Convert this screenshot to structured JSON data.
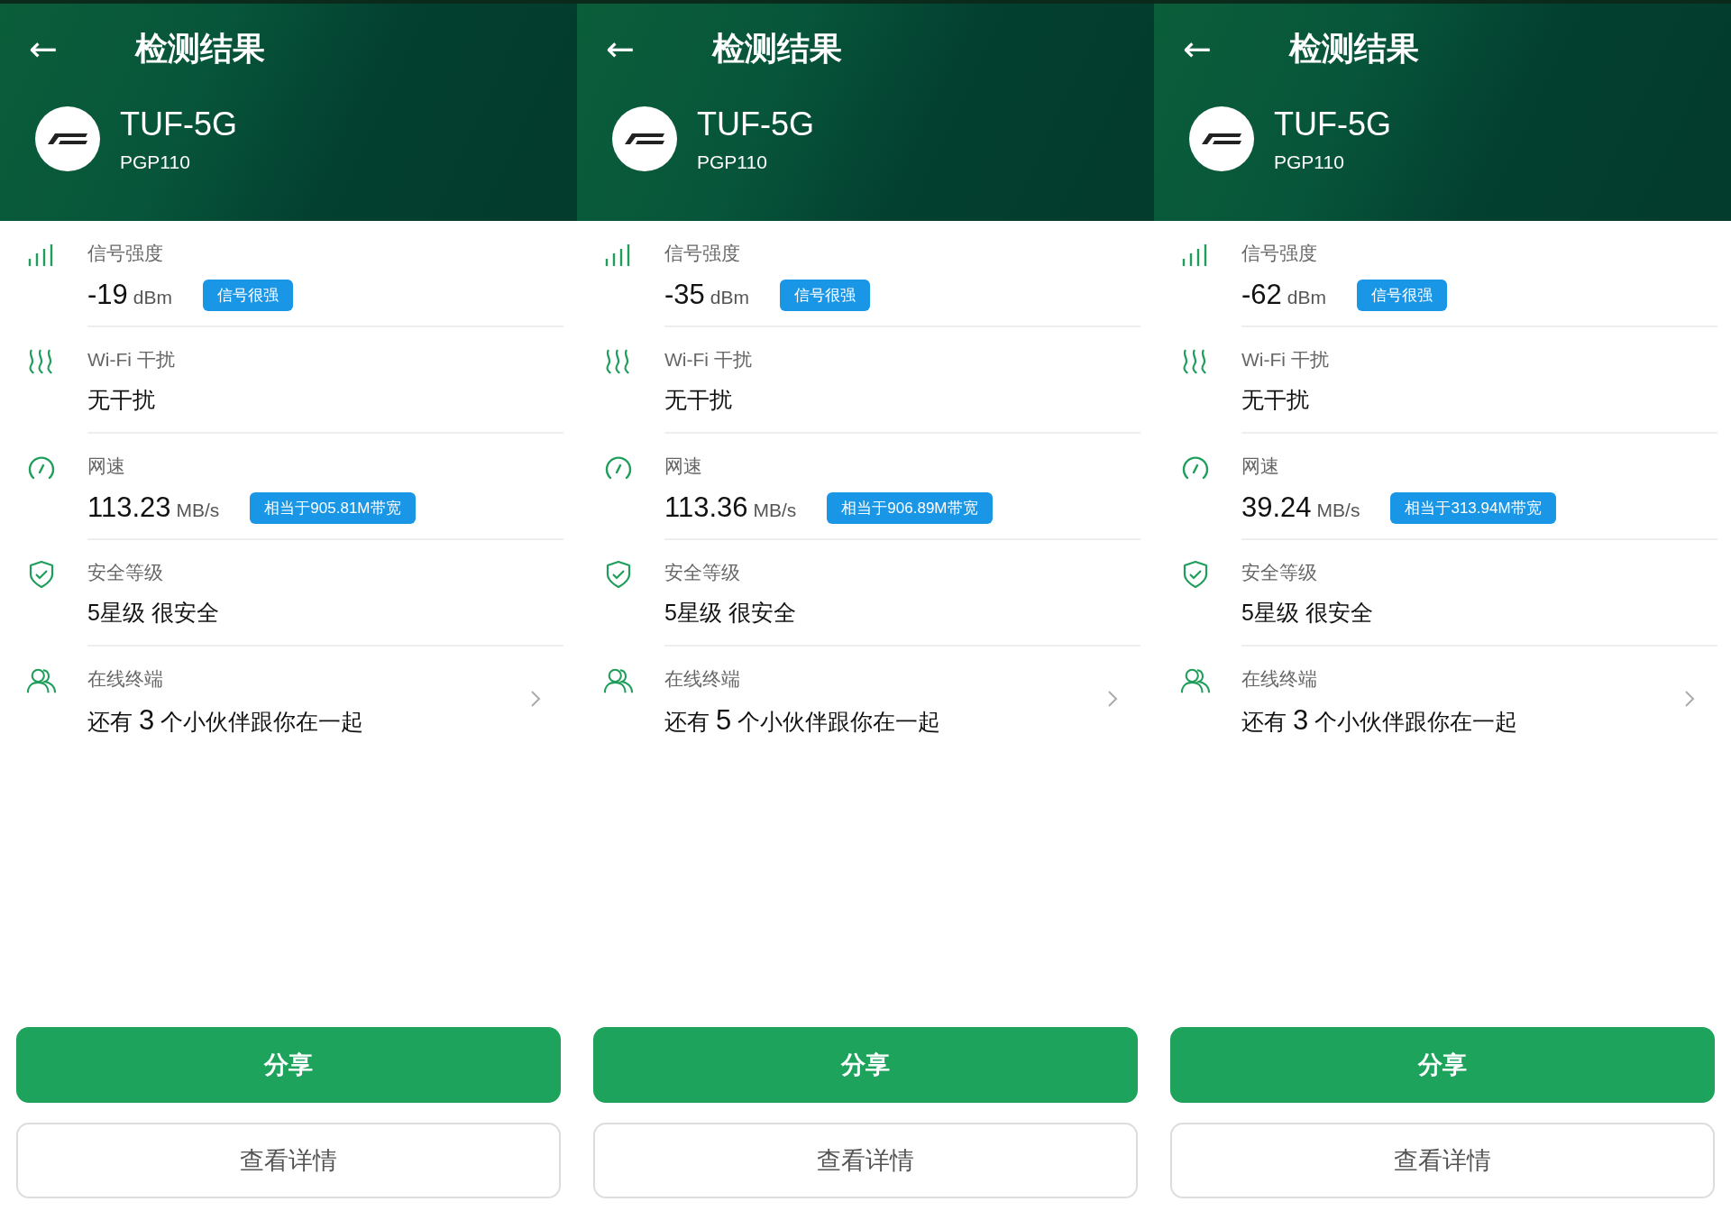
{
  "screens": [
    {
      "header": {
        "back": "←",
        "title": "检测结果"
      },
      "device": {
        "name": "TUF-5G",
        "model": "PGP110"
      },
      "rows": [
        {
          "kind": "signal",
          "label": "信号强度",
          "value": "-19",
          "unit": "dBm",
          "badge": "信号很强"
        },
        {
          "kind": "interference",
          "label": "Wi-Fi 干扰",
          "value": "无干扰"
        },
        {
          "kind": "speed",
          "label": "网速",
          "value": "113.23",
          "unit": "MB/s",
          "badge": "相当于905.81M带宽"
        },
        {
          "kind": "security",
          "label": "安全等级",
          "value": "5星级 很安全"
        },
        {
          "kind": "devices",
          "label": "在线终端",
          "value": "还有",
          "count": "3",
          "suffix": "个小伙伴跟你在一起"
        }
      ],
      "buttons": [
        {
          "kind": "primary",
          "label": "分享"
        },
        {
          "kind": "secondary",
          "label": "查看详情"
        }
      ]
    },
    {
      "header": {
        "back": "←",
        "title": "检测结果"
      },
      "device": {
        "name": "TUF-5G",
        "model": "PGP110"
      },
      "rows": [
        {
          "kind": "signal",
          "label": "信号强度",
          "value": "-35",
          "unit": "dBm",
          "badge": "信号很强"
        },
        {
          "kind": "interference",
          "label": "Wi-Fi 干扰",
          "value": "无干扰"
        },
        {
          "kind": "speed",
          "label": "网速",
          "value": "113.36",
          "unit": "MB/s",
          "badge": "相当于906.89M带宽"
        },
        {
          "kind": "security",
          "label": "安全等级",
          "value": "5星级 很安全"
        },
        {
          "kind": "devices",
          "label": "在线终端",
          "value": "还有",
          "count": "5",
          "suffix": "个小伙伴跟你在一起"
        }
      ],
      "buttons": [
        {
          "kind": "primary",
          "label": "分享"
        },
        {
          "kind": "secondary",
          "label": "查看详情"
        }
      ]
    },
    {
      "header": {
        "back": "←",
        "title": "检测结果"
      },
      "device": {
        "name": "TUF-5G",
        "model": "PGP110"
      },
      "rows": [
        {
          "kind": "signal",
          "label": "信号强度",
          "value": "-62",
          "unit": "dBm",
          "badge": "信号很强"
        },
        {
          "kind": "interference",
          "label": "Wi-Fi 干扰",
          "value": "无干扰"
        },
        {
          "kind": "speed",
          "label": "网速",
          "value": "39.24",
          "unit": "MB/s",
          "badge": "相当于313.94M带宽"
        },
        {
          "kind": "security",
          "label": "安全等级",
          "value": "5星级 很安全"
        },
        {
          "kind": "devices",
          "label": "在线终端",
          "value": "还有",
          "count": "3",
          "suffix": "个小伙伴跟你在一起"
        }
      ],
      "buttons": [
        {
          "kind": "primary",
          "label": "分享"
        },
        {
          "kind": "secondary",
          "label": "查看详情"
        }
      ]
    }
  ]
}
